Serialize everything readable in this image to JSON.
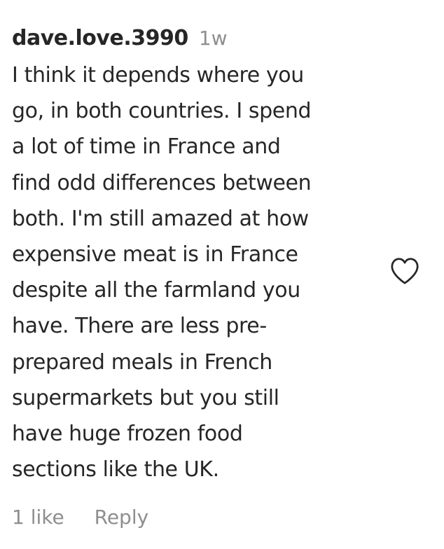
{
  "comment": {
    "username": "dave.love.3990",
    "timestamp": "1w",
    "text_lines": [
      "I think it depends where you",
      "go, in both countries. I spend",
      "a lot of time in France and",
      "find odd differences between",
      "both. I'm still amazed at how",
      "expensive meat is in France",
      "despite all the farmland you",
      "have. There are less pre-",
      "prepared meals in French",
      "supermarkets but you still",
      "have huge frozen food",
      "sections like the UK."
    ],
    "likes_label": "1 like",
    "reply_label": "Reply",
    "like_icon": "heart-outline-icon"
  },
  "colors": {
    "text": "#262626",
    "secondary": "#8e8e8e",
    "background": "#ffffff"
  }
}
